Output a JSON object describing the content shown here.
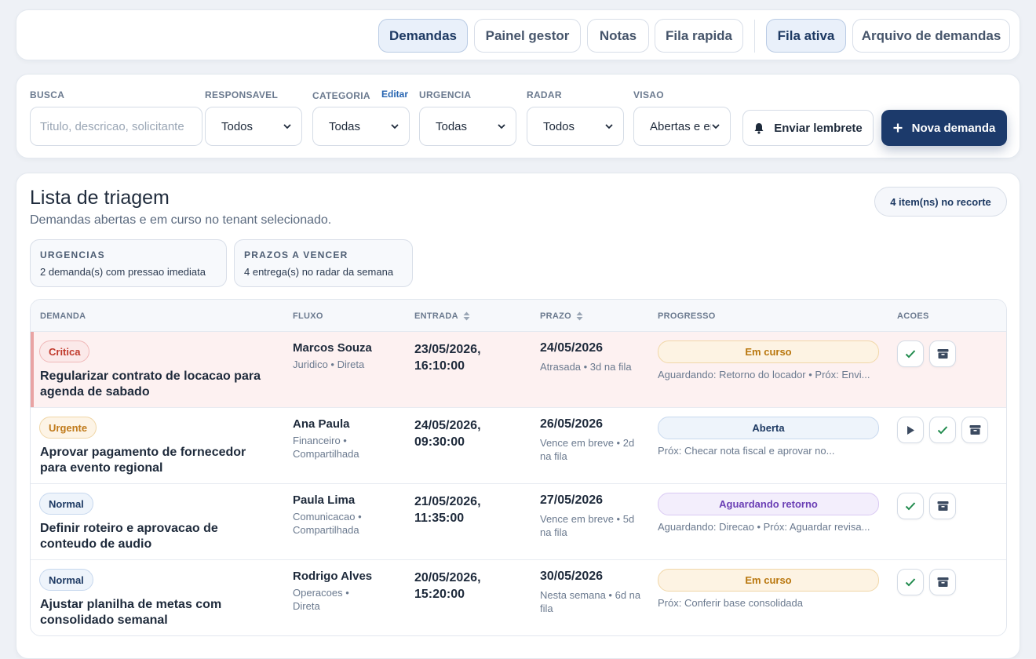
{
  "nav": {
    "tabs": [
      {
        "label": "Demandas"
      },
      {
        "label": "Painel gestor"
      },
      {
        "label": "Notas"
      },
      {
        "label": "Fila rapida"
      },
      {
        "label": "Fila ativa"
      },
      {
        "label": "Arquivo de demandas"
      }
    ]
  },
  "filters": {
    "search": {
      "label": "BUSCA",
      "placeholder": "Titulo, descricao, solicitante"
    },
    "responsavel": {
      "label": "RESPONSAVEL",
      "value": "Todos"
    },
    "categoria": {
      "label": "CATEGORIA",
      "edit_link": "Editar",
      "value": "Todas"
    },
    "urgencia": {
      "label": "URGENCIA",
      "value": "Todas"
    },
    "radar": {
      "label": "RADAR",
      "value": "Todos"
    },
    "visao": {
      "label": "VISAO",
      "value": "Abertas e em"
    },
    "remind_button": "Enviar lembrete",
    "new_button": "Nova demanda"
  },
  "main": {
    "title": "Lista de triagem",
    "subtitle": "Demandas abertas e em curso no tenant selecionado.",
    "count_pill": "4 item(ns) no recorte",
    "stats": [
      {
        "key": "URGENCIAS",
        "value": "2 demanda(s) com pressao imediata"
      },
      {
        "key": "PRAZOS A VENCER",
        "value": "4 entrega(s) no radar da semana"
      }
    ],
    "columns": {
      "demanda": "DEMANDA",
      "fluxo": "FLUXO",
      "entrada": "ENTRADA",
      "prazo": "PRAZO",
      "progresso": "PROGRESSO",
      "acoes": "ACOES"
    },
    "rows": [
      {
        "badge": "Critica",
        "title": "Regularizar contrato de locacao para agenda de sabado",
        "owner": "Marcos Souza",
        "flow_meta": "Juridico • Direta",
        "entry": "23/05/2026, 16:10:00",
        "due": "24/05/2026",
        "due_meta": "Atrasada • 3d na fila",
        "status": "Em curso",
        "next": "Aguardando: Retorno do locador • Próx: Envi..."
      },
      {
        "badge": "Urgente",
        "title": "Aprovar pagamento de fornecedor para evento regional",
        "owner": "Ana Paula",
        "flow_meta": "Financeiro • Compartilhada",
        "entry": "24/05/2026, 09:30:00",
        "due": "26/05/2026",
        "due_meta": "Vence em breve • 2d na fila",
        "status": "Aberta",
        "next": "Próx: Checar nota fiscal e aprovar no..."
      },
      {
        "badge": "Normal",
        "title": "Definir roteiro e aprovacao de conteudo de audio",
        "owner": "Paula Lima",
        "flow_meta": "Comunicacao • Compartilhada",
        "entry": "21/05/2026, 11:35:00",
        "due": "27/05/2026",
        "due_meta": "Vence em breve • 5d na fila",
        "status": "Aguardando retorno",
        "next": "Aguardando: Direcao • Próx: Aguardar revisa..."
      },
      {
        "badge": "Normal",
        "title": "Ajustar planilha de metas com consolidado semanal",
        "owner": "Rodrigo Alves",
        "flow_meta": "Operacoes • Direta",
        "entry": "20/05/2026, 15:20:00",
        "due": "30/05/2026",
        "due_meta": "Nesta semana • 6d na fila",
        "status": "Em curso",
        "next": "Próx: Conferir base consolidada"
      }
    ]
  },
  "colors": {
    "accent": "#1c3a6b",
    "critical": "#c0392b",
    "urgent": "#c07a1a",
    "normal": "#1e3a63",
    "in_progress": "#b9770e",
    "open": "#1e3a63",
    "waiting": "#6b3fb5"
  }
}
